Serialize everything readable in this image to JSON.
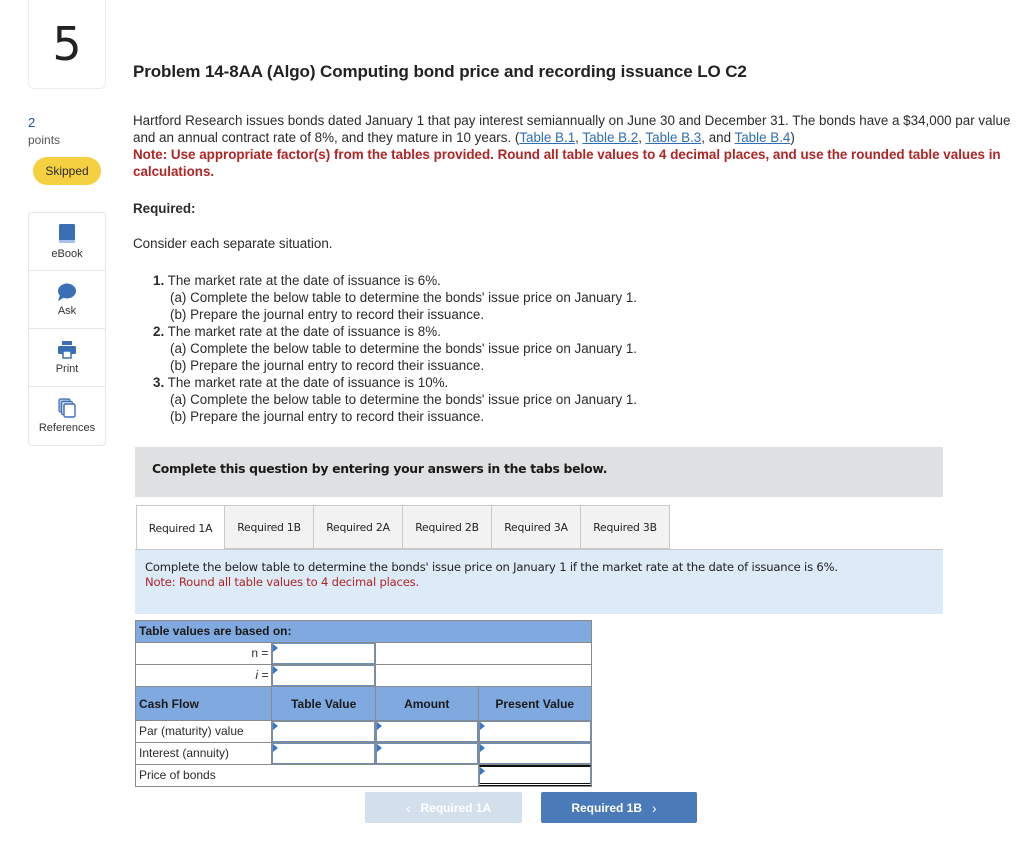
{
  "question": {
    "number": "5",
    "points_value": "2",
    "points_label": "points",
    "status_badge": "Skipped"
  },
  "tools": [
    {
      "label": "eBook",
      "icon": "book-icon"
    },
    {
      "label": "Ask",
      "icon": "chat-bubble-icon"
    },
    {
      "label": "Print",
      "icon": "printer-icon"
    },
    {
      "label": "References",
      "icon": "documents-icon"
    }
  ],
  "problem": {
    "title": "Problem 14-8AA (Algo) Computing bond price and recording issuance LO C2",
    "intro_part1": "Hartford Research issues bonds dated January 1 that pay interest semiannually on June 30 and December 31. The bonds have a $34,000 par value and an annual contract rate of 8%, and they mature in 10 years. (",
    "table_links": [
      "Table B.1",
      "Table B.2",
      "Table B.3",
      "Table B.4"
    ],
    "link_sep_1": ", ",
    "link_sep_2": ", ",
    "link_sep_3": ", and ",
    "intro_close": ")",
    "note": "Note: Use appropriate factor(s) from the tables provided. Round all table values to 4 decimal places, and use the rounded table values in calculations.",
    "required_heading": "Required:",
    "consider_text": "Consider each separate situation.",
    "requirements": [
      {
        "num": "1.",
        "text": "The market rate at the date of issuance is 6%.",
        "a": "(a) Complete the below table to determine the bonds' issue price on January 1.",
        "b": "(b) Prepare the journal entry to record their issuance."
      },
      {
        "num": "2.",
        "text": "The market rate at the date of issuance is 8%.",
        "a": "(a) Complete the below table to determine the bonds' issue price on January 1.",
        "b": "(b) Prepare the journal entry to record their issuance."
      },
      {
        "num": "3.",
        "text": "The market rate at the date of issuance is 10%.",
        "a": "(a) Complete the below table to determine the bonds' issue price on January 1.",
        "b": "(b) Prepare the journal entry to record their issuance."
      }
    ]
  },
  "instruction_bar": "Complete this question by entering your answers in the tabs below.",
  "tabs": [
    {
      "label": "Required 1A",
      "active": true
    },
    {
      "label": "Required 1B",
      "active": false
    },
    {
      "label": "Required 2A",
      "active": false
    },
    {
      "label": "Required 2B",
      "active": false
    },
    {
      "label": "Required 3A",
      "active": false
    },
    {
      "label": "Required 3B",
      "active": false
    }
  ],
  "tab_panel": {
    "instruction": "Complete the below table to determine the bonds' issue price on January 1 if the market rate at the date of issuance is 6%.",
    "note": "Note: Round all table values to 4 decimal places."
  },
  "pv_table": {
    "title": "Table values are based on:",
    "n_label": "n =",
    "i_label": "i =",
    "n_value": "",
    "i_value": "",
    "headers": [
      "Cash Flow",
      "Table Value",
      "Amount",
      "Present Value"
    ],
    "rows": [
      {
        "label": "Par (maturity) value",
        "table_value": "",
        "amount": "",
        "present_value": ""
      },
      {
        "label": "Interest (annuity)",
        "table_value": "",
        "amount": "",
        "present_value": ""
      }
    ],
    "total_label": "Price of bonds",
    "total_value": ""
  },
  "nav": {
    "prev_label": "Required 1A",
    "next_label": "Required 1B",
    "prev_chevron": "‹",
    "next_chevron": "›"
  },
  "colors": {
    "skipped_badge": "#f5d142",
    "note_red": "#b02525",
    "link_blue": "#2e6db4",
    "table_header_blue": "#7fa9df",
    "panel_blue": "#ddeaf7",
    "next_button": "#4a7ab8",
    "prev_button_disabled": "#d4dfed"
  }
}
